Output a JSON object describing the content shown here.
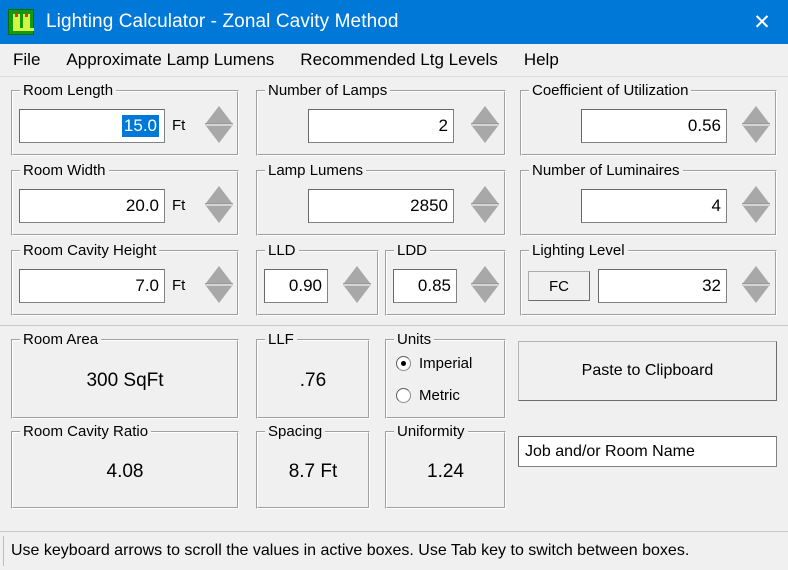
{
  "window": {
    "title": "Lighting Calculator - Zonal Cavity Method",
    "icon": "lamps-icon",
    "close_label": "✕"
  },
  "menu": {
    "items": [
      {
        "label": "File"
      },
      {
        "label": "Approximate Lamp Lumens"
      },
      {
        "label": "Recommended Ltg Levels"
      },
      {
        "label": "Help"
      }
    ]
  },
  "inputs": {
    "room_length": {
      "label": "Room Length",
      "value": "15.0",
      "unit": "Ft",
      "selected": true
    },
    "number_of_lamps": {
      "label": "Number of Lamps",
      "value": "2",
      "unit": ""
    },
    "coefficient_of_utilization": {
      "label": "Coefficient of Utilization",
      "value": "0.56",
      "unit": ""
    },
    "room_width": {
      "label": "Room Width",
      "value": "20.0",
      "unit": "Ft"
    },
    "lamp_lumens": {
      "label": "Lamp Lumens",
      "value": "2850",
      "unit": ""
    },
    "number_of_luminaires": {
      "label": "Number of Luminaires",
      "value": "4",
      "unit": ""
    },
    "room_cavity_height": {
      "label": "Room Cavity Height",
      "value": "7.0",
      "unit": "Ft"
    },
    "lld": {
      "label": "LLD",
      "value": "0.90",
      "unit": ""
    },
    "ldd": {
      "label": "LDD",
      "value": "0.85",
      "unit": ""
    },
    "lighting_level": {
      "label": "Lighting Level",
      "value": "32",
      "unit_button": "FC"
    }
  },
  "results": {
    "room_area": {
      "label": "Room Area",
      "value": "300 SqFt"
    },
    "llf": {
      "label": "LLF",
      "value": ".76"
    },
    "room_cavity_ratio": {
      "label": "Room Cavity Ratio",
      "value": "4.08"
    },
    "spacing": {
      "label": "Spacing",
      "value": "8.7 Ft"
    },
    "uniformity": {
      "label": "Uniformity",
      "value": "1.24"
    }
  },
  "units": {
    "label": "Units",
    "options": [
      {
        "label": "Imperial",
        "selected": true
      },
      {
        "label": "Metric",
        "selected": false
      }
    ]
  },
  "actions": {
    "paste_to_clipboard": "Paste to Clipboard",
    "job_name_value": "Job and/or Room Name"
  },
  "statusbar": {
    "text": "Use keyboard arrows to scroll the values in active boxes. Use Tab key to switch between boxes."
  },
  "colors": {
    "titlebar": "#0078d7",
    "selection": "#0078d7",
    "face": "#f0f0f0",
    "icon_green": "#0f9b0f"
  }
}
